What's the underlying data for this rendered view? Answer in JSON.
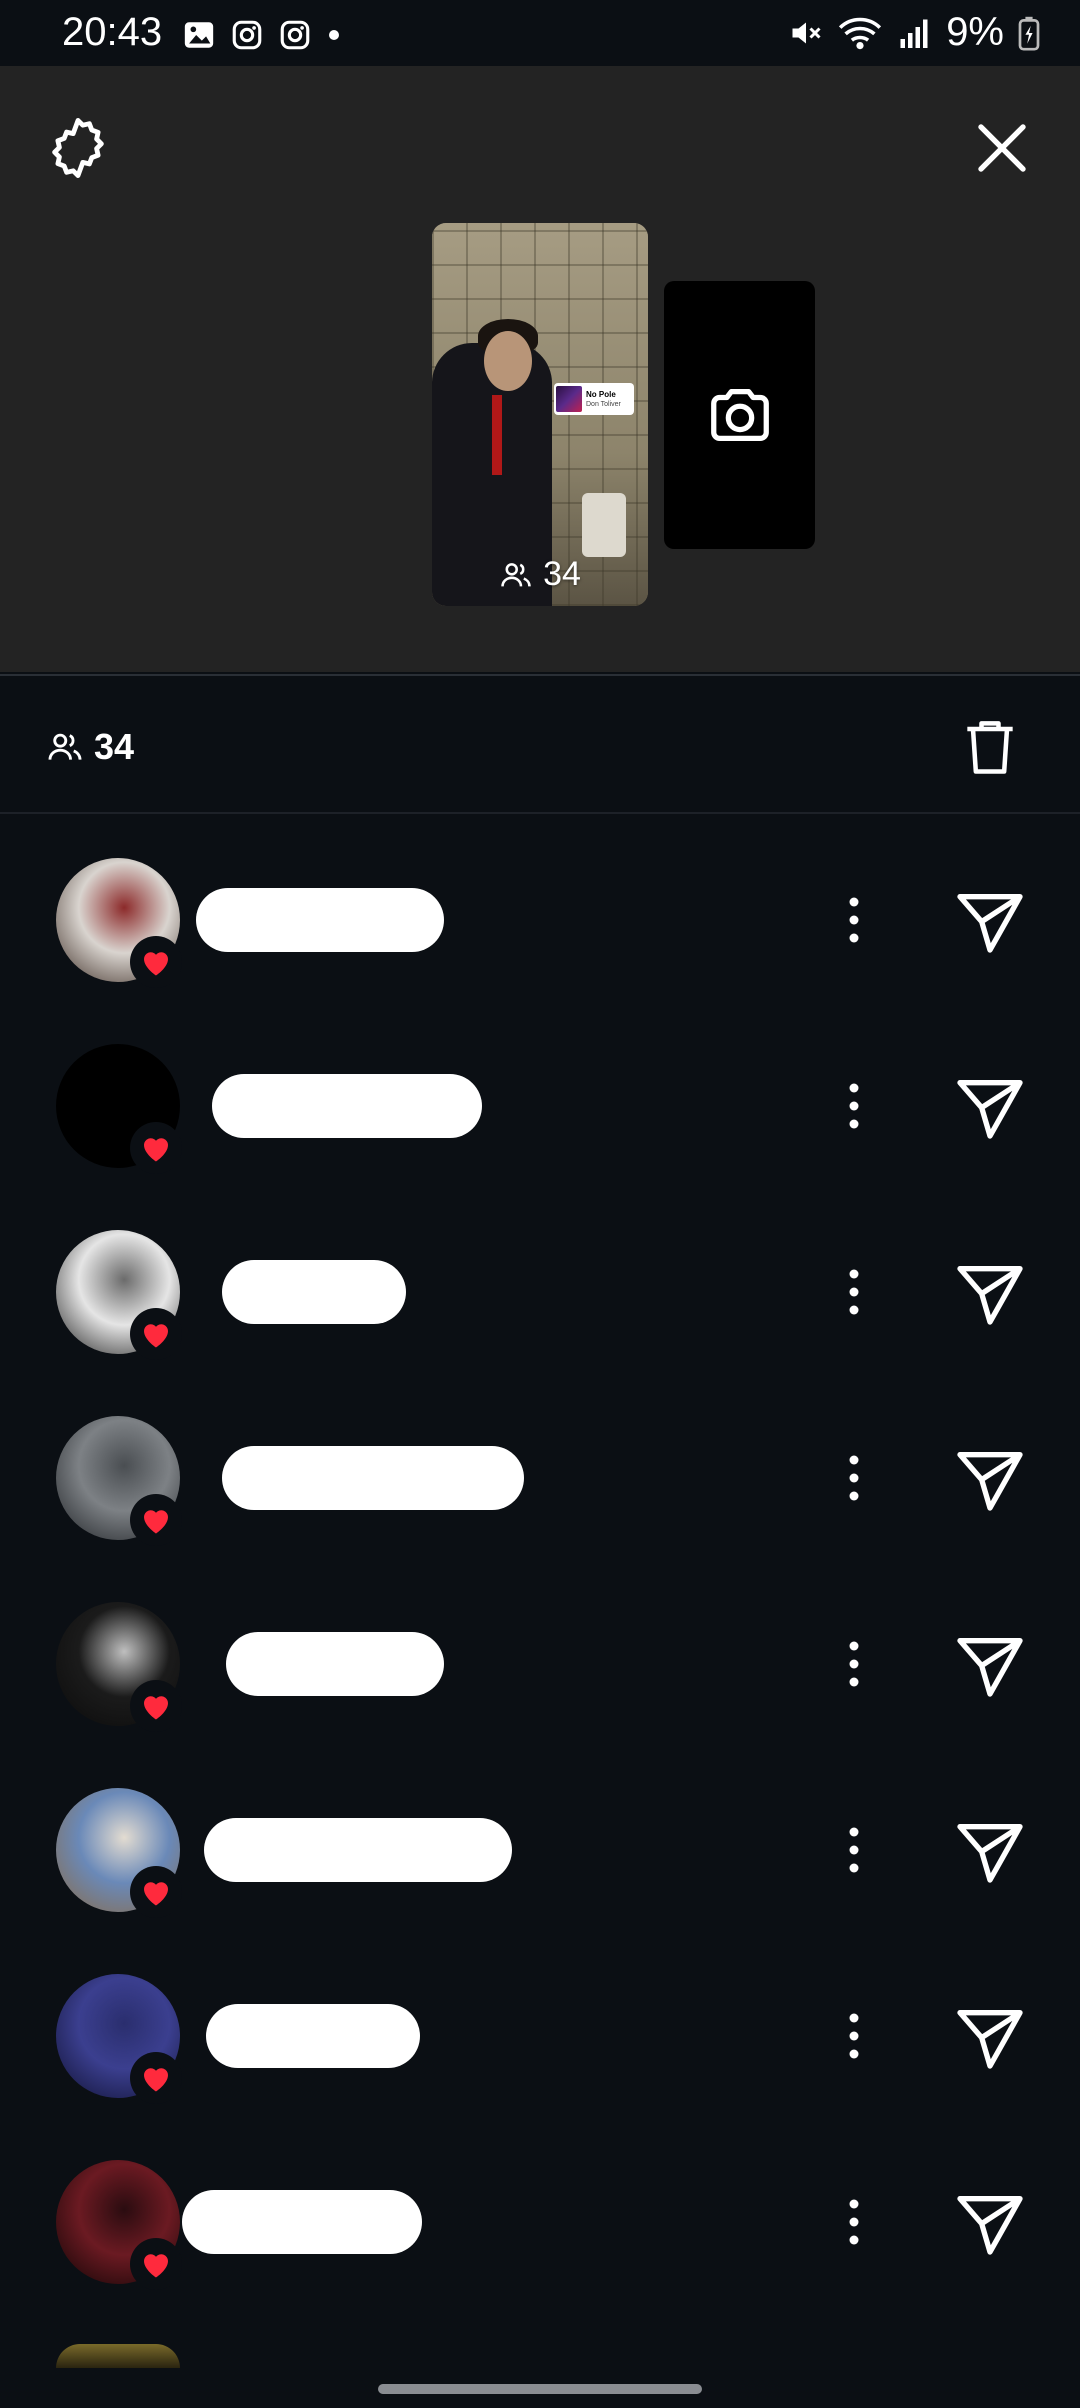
{
  "status_bar": {
    "time": "20:43",
    "battery": "9%"
  },
  "story": {
    "viewer_count": "34",
    "music_sticker": {
      "title": "No Pole",
      "artist": "Don Toliver"
    }
  },
  "viewers": {
    "count": "34",
    "items": [
      {
        "avatar": [
          "#d9d4cf",
          "#8c2a2a",
          "#3a2a22"
        ],
        "liked": true
      },
      {
        "avatar": [
          "#000000",
          "#000000",
          "#000000"
        ],
        "liked": true
      },
      {
        "avatar": [
          "#e5e5e5",
          "#6b6b6b",
          "#1c1c1c"
        ],
        "liked": true
      },
      {
        "avatar": [
          "#7d8185",
          "#4a4e52",
          "#1d2024"
        ],
        "liked": true
      },
      {
        "avatar": [
          "#1b1b1b",
          "#bfbfbf",
          "#0a0a0a"
        ],
        "liked": true
      },
      {
        "avatar": [
          "#6a89b8",
          "#e3dcd1",
          "#8a6a44"
        ],
        "liked": true
      },
      {
        "avatar": [
          "#3b3f8f",
          "#2a2e6e",
          "#0f1030"
        ],
        "liked": true
      },
      {
        "avatar": [
          "#6b1a22",
          "#2a0c10",
          "#0c0404"
        ],
        "liked": true
      }
    ]
  },
  "colors": {
    "background": "#0b0f14",
    "preview_background": "#232323",
    "heart": "#ff2a3d",
    "redaction": "#ffffff"
  },
  "icons": {
    "settings": "gear-icon",
    "close": "close-icon",
    "camera": "camera-icon",
    "viewers": "people-icon",
    "delete": "trash-icon",
    "more": "more-vertical-icon",
    "send": "send-icon",
    "like": "heart-icon"
  }
}
